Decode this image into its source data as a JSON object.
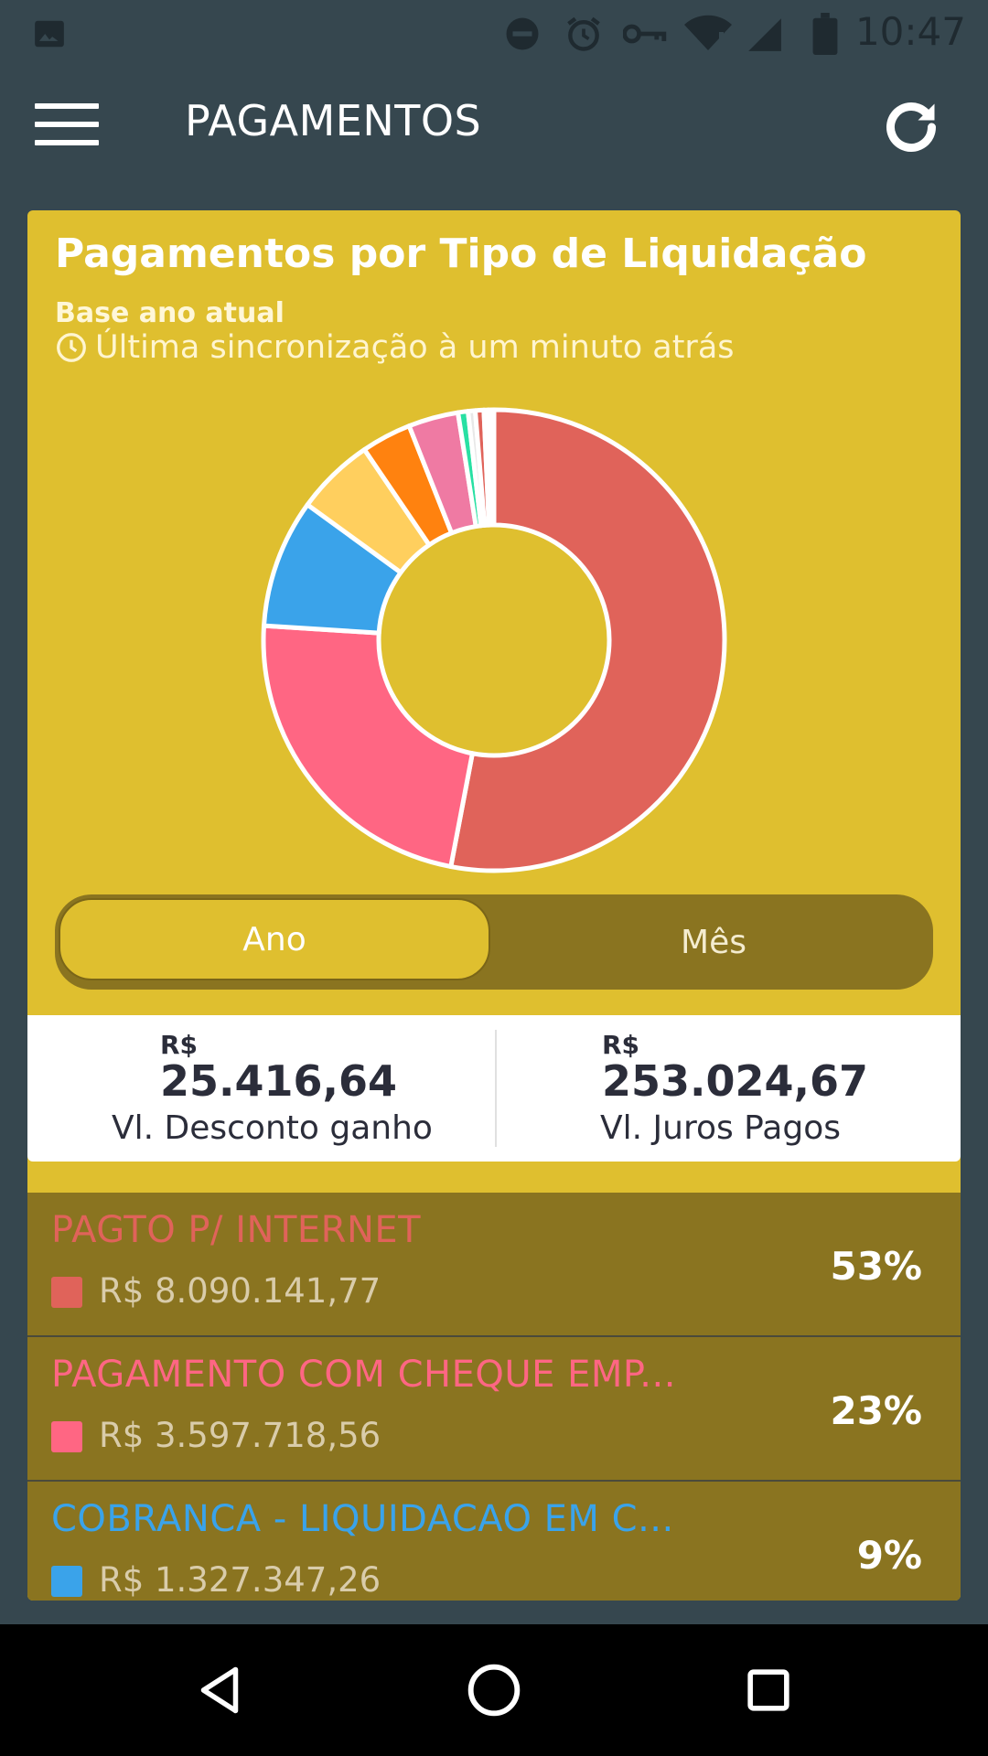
{
  "status_bar": {
    "time": "10:47",
    "icons": [
      "image-icon",
      "do-not-disturb-icon",
      "alarm-icon",
      "vpn-key-icon",
      "wifi-icon",
      "signal-icon",
      "battery-icon"
    ]
  },
  "app_bar": {
    "title": "PAGAMENTOS",
    "menu_icon": "hamburger-menu-icon",
    "refresh_icon": "refresh-icon"
  },
  "card": {
    "title": "Pagamentos por Tipo de Liquidação",
    "subtitle": "Base ano atual",
    "sync_text": "Última sincronização à um minuto atrás",
    "background": "#dfbf2f"
  },
  "chart_data": {
    "type": "pie",
    "donut": true,
    "slices": [
      {
        "label": "PAGTO P/ INTERNET",
        "percent": 53,
        "color": "#e0635a"
      },
      {
        "label": "PAGAMENTO COM CHEQUE EMP...",
        "percent": 23,
        "color": "#ff6683"
      },
      {
        "percent": 9,
        "color": "#3aa3ea"
      },
      {
        "percent": 5.5,
        "color": "#ffcf5e"
      },
      {
        "percent": 3.5,
        "color": "#ff820f"
      },
      {
        "percent": 3.5,
        "color": "#ef7aa3"
      },
      {
        "percent": 0.7,
        "color": "#28e0a3"
      },
      {
        "percent": 0.5,
        "color": "#e8e8e8"
      },
      {
        "percent": 0.6,
        "color": "#e0635a"
      },
      {
        "percent": 0.3,
        "color": "#a0a0ff"
      },
      {
        "percent": 0.4,
        "color": "#ffffff"
      }
    ]
  },
  "toggle": {
    "ano": "Ano",
    "mes": "Mês",
    "selected": "Ano"
  },
  "totals": {
    "desconto": {
      "currency": "R$",
      "value": "25.416,64",
      "label": "Vl. Desconto ganho"
    },
    "juros": {
      "currency": "R$",
      "value": "253.024,67",
      "label": "Vl. Juros Pagos"
    }
  },
  "list": [
    {
      "name": "PAGTO P/ INTERNET",
      "amount": "R$ 8.090.141,77",
      "percent": "53%",
      "color": "#e0635a"
    },
    {
      "name": "PAGAMENTO COM CHEQUE EMP...",
      "amount": "R$ 3.597.718,56",
      "percent": "23%",
      "color": "#ff6683"
    },
    {
      "name": "COBRANCA - LIQUIDACAO EM C...",
      "amount": "R$ 1.327.347,26",
      "percent": "9%",
      "color": "#3aa3ea"
    }
  ],
  "nav_bar": {
    "back_icon": "back-triangle-icon",
    "home_icon": "home-circle-icon",
    "recents_icon": "recents-square-icon"
  }
}
